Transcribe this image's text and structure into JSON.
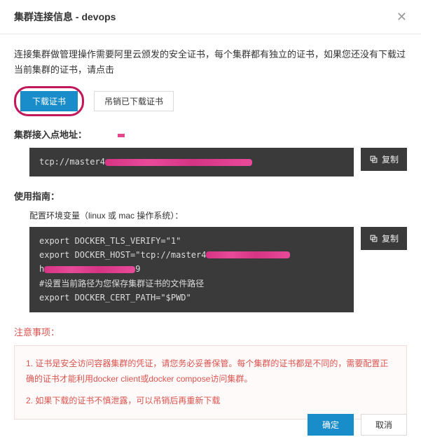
{
  "header": {
    "title": "集群连接信息 - devops"
  },
  "intro": "连接集群做管理操作需要阿里云颁发的安全证书，每个集群都有独立的证书，如果您还没有下载过当前集群的证书，请点击",
  "buttons": {
    "download": "下载证书",
    "revoke": "吊销已下载证书"
  },
  "endpoint": {
    "label": "集群接入点地址：",
    "code_prefix": "tcp://master4"
  },
  "copy_label": "复制",
  "guide": {
    "label": "使用指南：",
    "sublabel": "配置环境变量（linux 或 mac 操作系统）：",
    "line1": "export DOCKER_TLS_VERIFY=\"1\"",
    "line2_prefix": "export DOCKER_HOST=\"tcp://master4",
    "line3_prefix": "h",
    "line3_suffix": "9",
    "line4": "#设置当前路径为您保存集群证书的文件路径",
    "line5": "export DOCKER_CERT_PATH=\"$PWD\""
  },
  "notice": {
    "title": "注意事项：",
    "item1": "1. 证书是安全访问容器集群的凭证，请您务必妥善保管。每个集群的证书都是不同的，需要配置正确的证书才能利用docker client或docker compose访问集群。",
    "item2": "2. 如果下载的证书不慎泄露，可以吊销后再重新下载"
  },
  "footer": {
    "ok": "确定",
    "cancel": "取消"
  }
}
